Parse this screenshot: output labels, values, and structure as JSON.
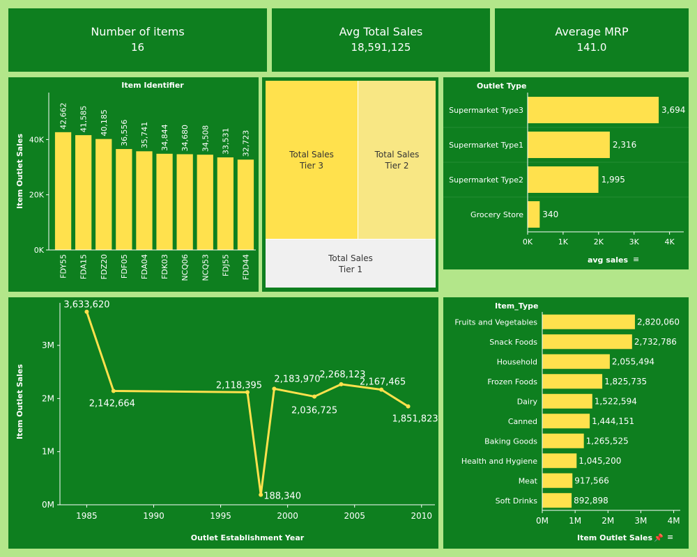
{
  "colors": {
    "background": "#b3e68a",
    "panel": "#0e7f1f",
    "bar": "#ffe14d",
    "tier3": "#ffe14d",
    "tier2": "#f8e784",
    "tier1": "#f0f0f0",
    "axis": "#ffffff"
  },
  "kpis": [
    {
      "title": "Number of items",
      "value": "16"
    },
    {
      "title": "Avg Total Sales",
      "value": "18,591,125"
    },
    {
      "title": "Average MRP",
      "value": "141.0"
    }
  ],
  "treemap": {
    "tier3": "Total Sales\nTier 3",
    "tier2": "Total Sales\nTier 2",
    "tier1": "Total Sales\nTier 1"
  },
  "chart_data": [
    {
      "id": "item-identifier",
      "type": "bar",
      "title": "Item Identifier",
      "ylabel": "Item Outlet Sales",
      "categories": [
        "FDY55",
        "FDA15",
        "FDZ20",
        "FDF05",
        "FDA04",
        "FDK03",
        "NCQ06",
        "NCQ53",
        "FDJ55",
        "FDD44"
      ],
      "values": [
        42662,
        41585,
        40185,
        36556,
        35741,
        34844,
        34680,
        34508,
        33531,
        32723
      ],
      "value_labels": [
        "42,662",
        "41,585",
        "40,185",
        "36,556",
        "35,741",
        "34,844",
        "34,680",
        "34,508",
        "33,531",
        "32,723"
      ],
      "yticks": [
        0,
        20000,
        40000
      ],
      "ytick_labels": [
        "0K",
        "20K",
        "40K"
      ],
      "ylim": [
        0,
        57000
      ]
    },
    {
      "id": "outlet-type",
      "type": "bar",
      "orientation": "horizontal",
      "title": "Outlet Type",
      "xlabel": "avg sales",
      "categories": [
        "Supermarket Type3",
        "Supermarket Type1",
        "Supermarket Type2",
        "Grocery Store"
      ],
      "values": [
        3694,
        2316,
        1995,
        340
      ],
      "value_labels": [
        "3,694",
        "2,316",
        "1,995",
        "340"
      ],
      "xticks": [
        0,
        1000,
        2000,
        3000,
        4000
      ],
      "xtick_labels": [
        "0K",
        "1K",
        "2K",
        "3K",
        "4K"
      ],
      "xlim": [
        0,
        4400
      ]
    },
    {
      "id": "establishment-year",
      "type": "line",
      "xlabel": "Outlet Establishment Year",
      "ylabel": "Item Outlet Sales",
      "x": [
        1985,
        1987,
        1997,
        1998,
        1999,
        2002,
        2004,
        2007,
        2009
      ],
      "y": [
        3633620,
        2142664,
        2118395,
        188340,
        2183970,
        2036725,
        2268123,
        2167465,
        1851823
      ],
      "value_labels": [
        "3,633,620",
        "2,142,664",
        "2,118,395",
        "188,340",
        "2,183,970",
        "2,036,725",
        "2,268,123",
        "2,167,465",
        "1,851,823"
      ],
      "xticks": [
        1985,
        1990,
        1995,
        2000,
        2005,
        2010
      ],
      "xtick_labels": [
        "1985",
        "1990",
        "1995",
        "2000",
        "2005",
        "2010"
      ],
      "yticks": [
        0,
        1000000,
        2000000,
        3000000
      ],
      "ytick_labels": [
        "0M",
        "1M",
        "2M",
        "3M"
      ],
      "xlim": [
        1983,
        2011
      ],
      "ylim": [
        0,
        3800000
      ]
    },
    {
      "id": "item-type",
      "type": "bar",
      "orientation": "horizontal",
      "title": "Item_Type",
      "xlabel": "Item Outlet Sales",
      "categories": [
        "Fruits and Vegetables",
        "Snack Foods",
        "Household",
        "Frozen Foods",
        "Dairy",
        "Canned",
        "Baking Goods",
        "Health and Hygiene",
        "Meat",
        "Soft Drinks"
      ],
      "values": [
        2820060,
        2732786,
        2055494,
        1825735,
        1522594,
        1444151,
        1265525,
        1045200,
        917566,
        892898
      ],
      "value_labels": [
        "2,820,060",
        "2,732,786",
        "2,055,494",
        "1,825,735",
        "1,522,594",
        "1,444,151",
        "1,265,525",
        "1,045,200",
        "917,566",
        "892,898"
      ],
      "xticks": [
        0,
        1000000,
        2000000,
        3000000,
        4000000
      ],
      "xtick_labels": [
        "0M",
        "1M",
        "2M",
        "3M",
        "4M"
      ],
      "xlim": [
        0,
        4200000
      ]
    }
  ]
}
